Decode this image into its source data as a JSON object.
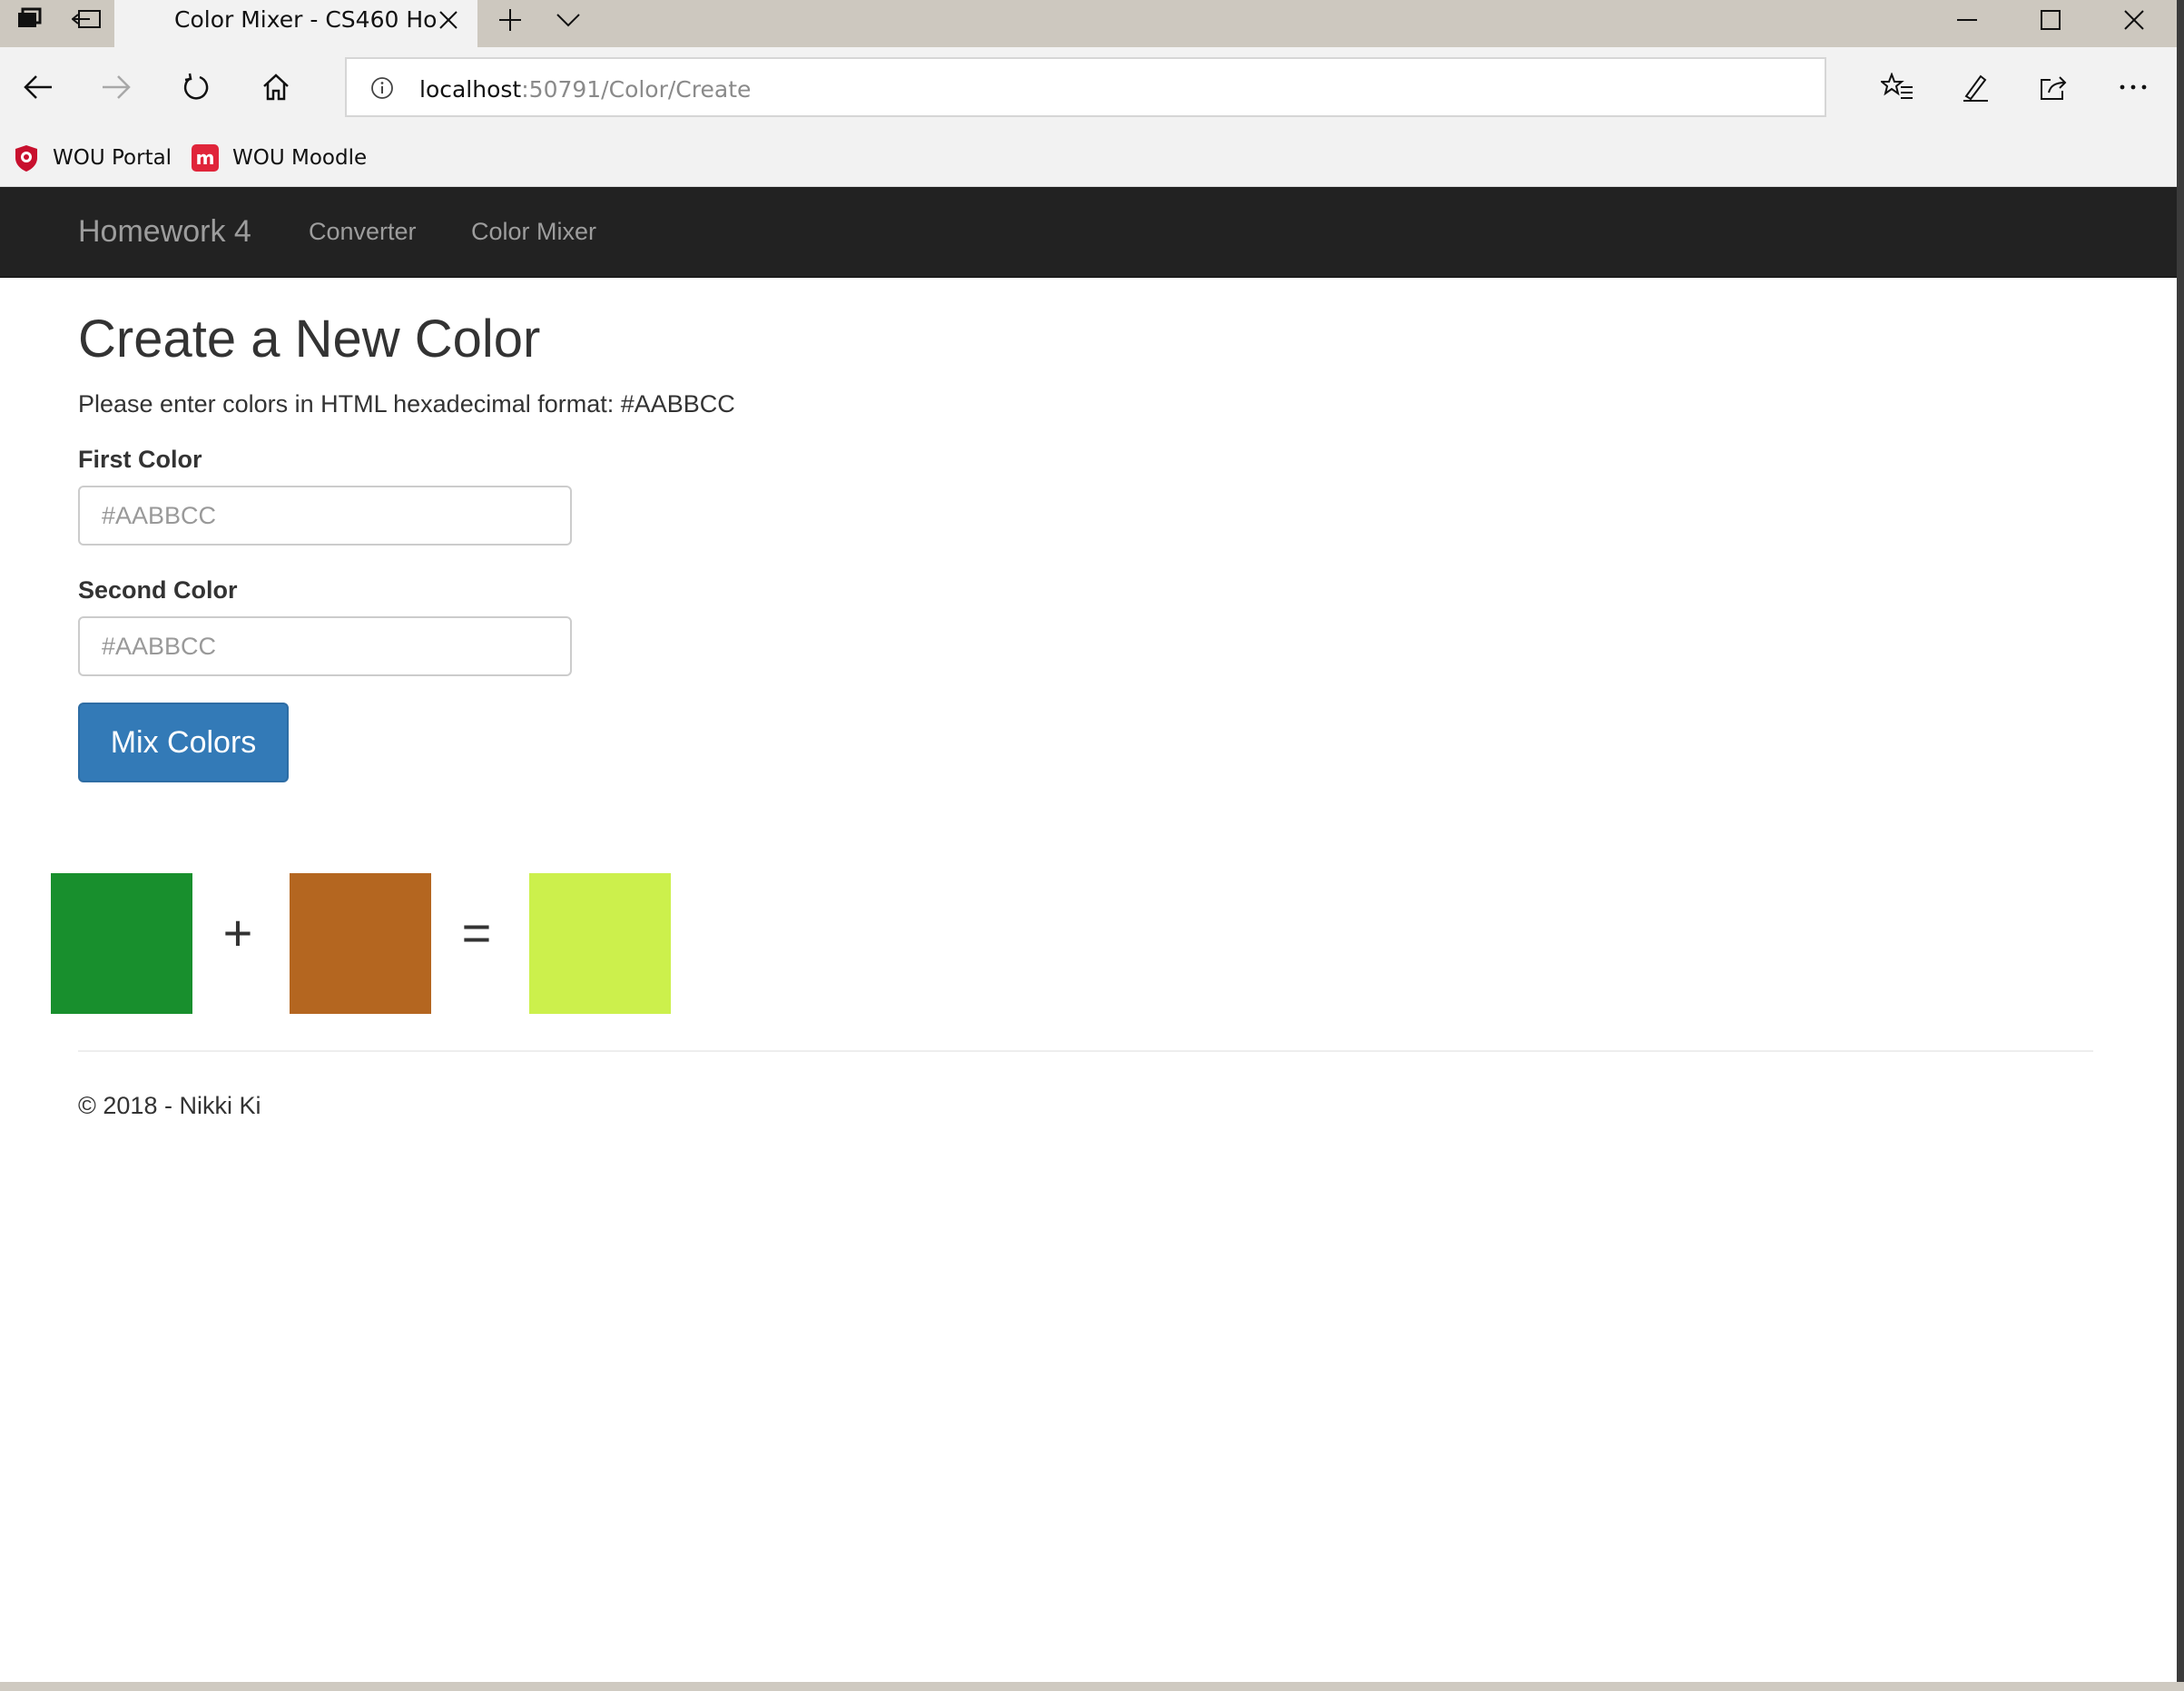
{
  "browser": {
    "tab_title": "Color Mixer - CS460 Ho",
    "url_host": "localhost",
    "url_rest": ":50791/Color/Create",
    "favorites": [
      {
        "label": "WOU Portal",
        "icon": "wou-portal-shield-icon"
      },
      {
        "label": "WOU Moodle",
        "icon": "moodle-icon"
      }
    ]
  },
  "site": {
    "brand": "Homework 4",
    "nav": [
      "Converter",
      "Color Mixer"
    ]
  },
  "page": {
    "title": "Create a New Color",
    "intro": "Please enter colors in HTML hexadecimal format: #AABBCC",
    "first_label": "First Color",
    "first_placeholder": "#AABBCC",
    "second_label": "Second Color",
    "second_placeholder": "#AABBCC",
    "button": "Mix Colors",
    "plus": "+",
    "equals": "=",
    "footer": "© 2018 - Nikki Ki"
  },
  "colors": {
    "first": "#188F2D",
    "second": "#B46620",
    "result": "#CCF04C",
    "primary_button": "#337AB7",
    "navbar": "#222222"
  }
}
